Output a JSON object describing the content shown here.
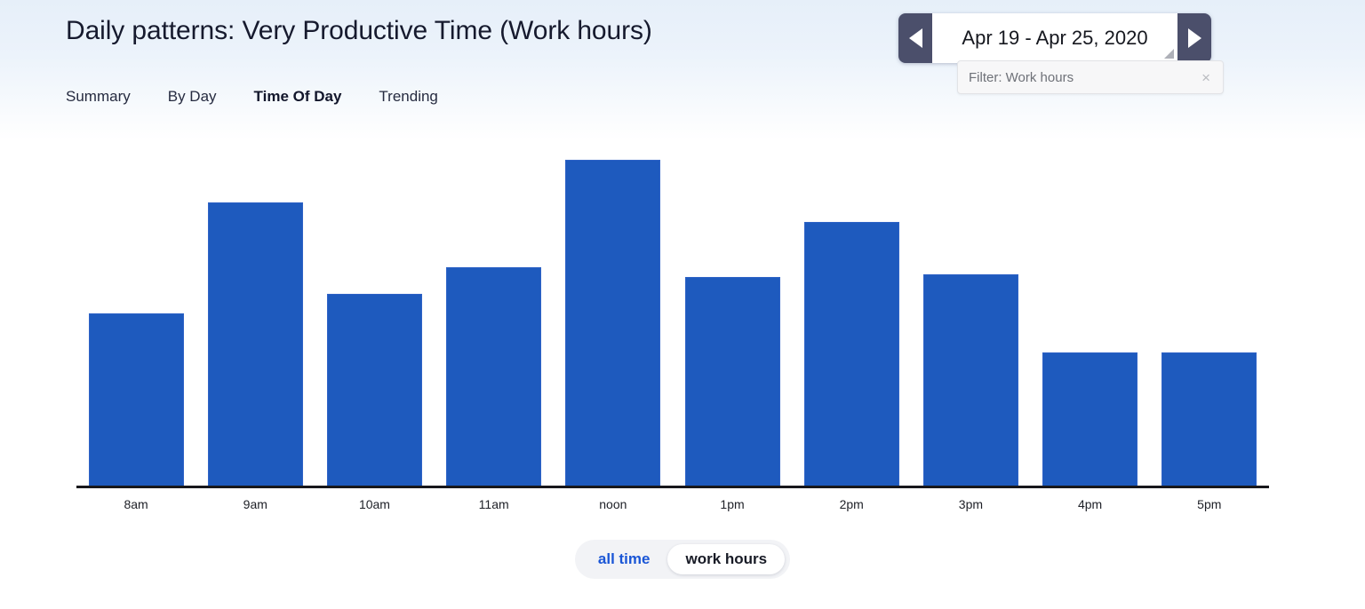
{
  "header": {
    "title": "Daily patterns: Very Productive Time (Work hours)",
    "tabs": [
      {
        "label": "Summary",
        "active": false
      },
      {
        "label": "By Day",
        "active": false
      },
      {
        "label": "Time Of Day",
        "active": true
      },
      {
        "label": "Trending",
        "active": false
      }
    ],
    "date_range": {
      "value": "Apr 19 - Apr 25, 2020",
      "prev_icon": "triangle-left-icon",
      "next_icon": "triangle-right-icon",
      "resize_icon": "resize-handle-icon"
    },
    "filter": {
      "label": "Filter: Work hours",
      "close_icon": "close-icon"
    }
  },
  "toggle": {
    "options": [
      {
        "label": "all time",
        "selected": false
      },
      {
        "label": "work hours",
        "selected": true
      }
    ]
  },
  "colors": {
    "bar_fill": "#1e5abe",
    "bar_stroke": "#2f63c6",
    "axis": "#17171c",
    "accent_link": "#1a56d6",
    "header_gradient_top": "#e6eff9",
    "header_gradient_bottom": "#ffffff",
    "picker_button": "#4b4f6b"
  },
  "chart_data": {
    "type": "bar",
    "title": "Daily patterns: Very Productive Time (Work hours)",
    "xlabel": "",
    "ylabel": "",
    "grid": false,
    "legend": "none",
    "categories": [
      "8am",
      "9am",
      "10am",
      "11am",
      "noon",
      "1pm",
      "2pm",
      "3pm",
      "4pm",
      "5pm"
    ],
    "values": [
      53,
      87,
      59,
      67,
      100,
      64,
      81,
      65,
      41,
      41
    ],
    "ylim": [
      0,
      100
    ],
    "value_unit": "relative height (% of tallest bar)"
  }
}
